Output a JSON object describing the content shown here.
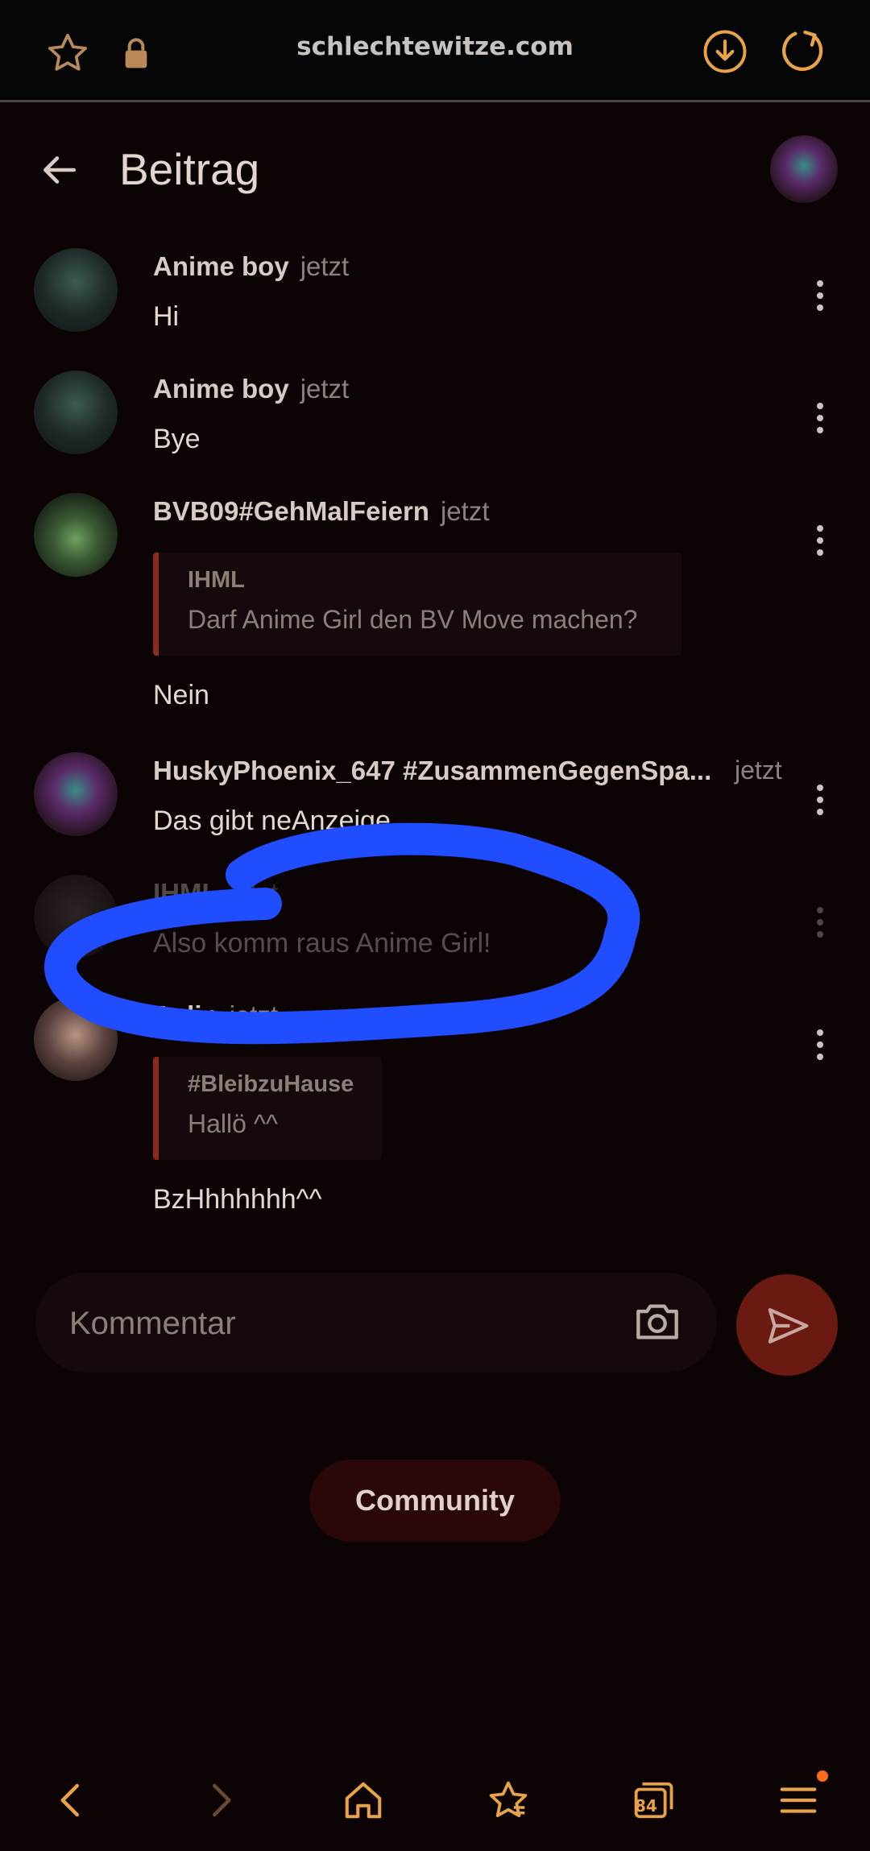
{
  "browser": {
    "url": "schlechtewitze.com",
    "icons": [
      "star-icon",
      "lock-icon",
      "download-icon",
      "reload-icon"
    ],
    "accent": "#e8a24a"
  },
  "header": {
    "title": "Beitrag"
  },
  "comments": [
    {
      "author": "Anime boy",
      "time": "jetzt",
      "text": "Hi"
    },
    {
      "author": "Anime boy",
      "time": "jetzt",
      "text": "Bye"
    },
    {
      "author": "BVB09#GehMalFeiern",
      "time": "jetzt",
      "quote": {
        "author": "IHML",
        "text": "Darf Anime Girl den BV Move machen?"
      },
      "text": "Nein"
    },
    {
      "author": "HuskyPhoenix_647 #ZusammenGegenSpa...",
      "time": "jetzt",
      "text": "Das gibt neAnzeige"
    },
    {
      "author": "IHML",
      "time": "jetzt",
      "text": "Also komm raus Anime Girl!"
    },
    {
      "author": "Aelin",
      "time": "jetzt",
      "quote": {
        "author": "#BleibzuHause",
        "text": "Hallö ^^"
      },
      "text": "BzHhhhhhh^^"
    }
  ],
  "composer": {
    "placeholder": "Kommentar"
  },
  "community_button": "Community",
  "bottom_nav": {
    "tab_count": "84",
    "icons": [
      "back-icon",
      "forward-icon",
      "home-icon",
      "bookmarks-icon",
      "tabs-icon",
      "menu-icon"
    ]
  },
  "colors": {
    "background": "#0b0304",
    "send_button": "#6a1a10",
    "quote_bar": "#8a2a20",
    "scribble": "#1f4dff"
  }
}
